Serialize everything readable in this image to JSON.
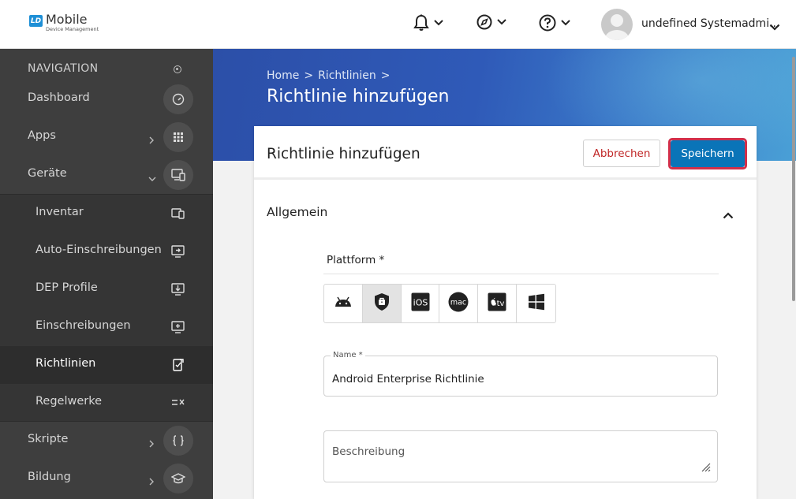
{
  "header": {
    "logo_badge": "LD",
    "logo_title": "Mobile",
    "logo_subtitle": "Device Management",
    "user_name": "undefined Systemadmi..."
  },
  "sidebar": {
    "title": "NAVIGATION",
    "items": [
      {
        "label": "Dashboard",
        "icon": "speedometer-icon"
      },
      {
        "label": "Apps",
        "icon": "grid-icon",
        "has_chevron": true
      },
      {
        "label": "Geräte",
        "icon": "devices-icon",
        "expanded": true
      },
      {
        "label": "Inventar",
        "icon": "inventory-icon",
        "sub": true
      },
      {
        "label": "Auto-Einschreibungen",
        "icon": "auto-enroll-icon",
        "sub": true
      },
      {
        "label": "DEP Profile",
        "icon": "dep-profile-icon",
        "sub": true
      },
      {
        "label": "Einschreibungen",
        "icon": "enrollment-icon",
        "sub": true
      },
      {
        "label": "Richtlinien",
        "icon": "policy-icon",
        "sub": true,
        "active": true
      },
      {
        "label": "Regelwerke",
        "icon": "ruleset-icon",
        "sub": true
      },
      {
        "label": "Skripte",
        "icon": "code-braces-icon",
        "has_chevron": true
      },
      {
        "label": "Bildung",
        "icon": "graduation-cap-icon",
        "has_chevron": true
      }
    ]
  },
  "hero": {
    "breadcrumb": [
      "Home",
      ">",
      "Richtlinien",
      ">"
    ],
    "title": "Richtlinie hinzufügen"
  },
  "card": {
    "title": "Richtlinie hinzufügen",
    "cancel_label": "Abbrechen",
    "save_label": "Speichern",
    "section_title": "Allgemein",
    "platform_label": "Plattform *",
    "platforms": [
      {
        "name": "android-icon"
      },
      {
        "name": "android-enterprise-icon",
        "selected": true
      },
      {
        "name": "ios-icon",
        "text": "iOS"
      },
      {
        "name": "macos-icon",
        "text": "mac"
      },
      {
        "name": "apple-tv-icon",
        "text": "tv"
      },
      {
        "name": "windows-icon"
      }
    ],
    "name_label": "Name *",
    "name_value": "Android Enterprise Richtlinie",
    "description_placeholder": "Beschreibung"
  },
  "colors": {
    "primary": "#0a74b8",
    "cancel_text": "#c02727",
    "highlight": "#d22f4a",
    "sidebar_bg": "#3e3e3e"
  }
}
